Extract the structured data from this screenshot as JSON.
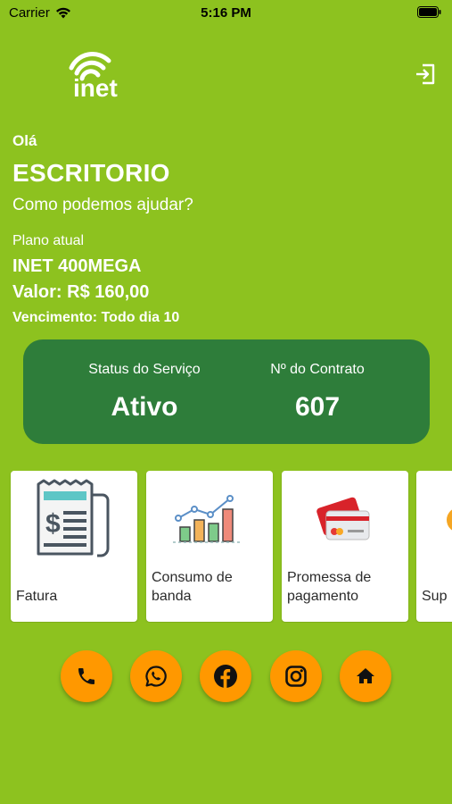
{
  "status_bar": {
    "carrier": "Carrier",
    "time": "5:16 PM"
  },
  "header": {
    "logo_text": "inet"
  },
  "greeting": {
    "hello": "Olá",
    "name": "ESCRITORIO",
    "help": "Como podemos ajudar?"
  },
  "plan": {
    "label": "Plano atual",
    "name": "INET 400MEGA",
    "value": "Valor: R$ 160,00",
    "due": "Vencimento: Todo dia 10"
  },
  "service": {
    "status_label": "Status do Serviço",
    "status_value": "Ativo",
    "contract_label": "Nº do Contrato",
    "contract_value": "607"
  },
  "tiles": [
    {
      "label": "Fatura",
      "icon": "invoice-icon"
    },
    {
      "label": "Consumo de banda",
      "icon": "bandwidth-chart-icon"
    },
    {
      "label": "Promessa de pagamento",
      "icon": "credit-card-icon"
    },
    {
      "label": "Sup",
      "icon": "support-icon"
    }
  ],
  "actions": [
    {
      "icon": "phone-icon"
    },
    {
      "icon": "whatsapp-icon"
    },
    {
      "icon": "facebook-icon"
    },
    {
      "icon": "instagram-icon"
    },
    {
      "icon": "home-icon"
    }
  ],
  "colors": {
    "background": "#8dc21f",
    "service_card": "#2e7d3a",
    "action_button": "#ff9800"
  }
}
